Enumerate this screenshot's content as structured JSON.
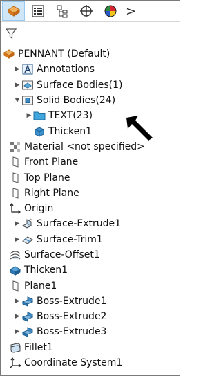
{
  "toolbar": {
    "buttons": [
      {
        "icon": "feature-manager-icon",
        "active": true
      },
      {
        "icon": "property-manager-icon",
        "active": false
      },
      {
        "icon": "configuration-manager-icon",
        "active": false
      },
      {
        "icon": "dimxpert-manager-icon",
        "active": false
      },
      {
        "icon": "display-manager-icon",
        "active": false
      }
    ],
    "more_label": ">"
  },
  "tree": {
    "root": "PENNANT (Default)",
    "items": [
      {
        "label": "Annotations"
      },
      {
        "label": "Surface Bodies(1)"
      },
      {
        "label": "Solid Bodies(24)"
      },
      {
        "label": "TEXT(23)"
      },
      {
        "label": "Thicken1"
      },
      {
        "label": "Material <not specified>"
      },
      {
        "label": "Front Plane"
      },
      {
        "label": "Top Plane"
      },
      {
        "label": "Right Plane"
      },
      {
        "label": "Origin"
      },
      {
        "label": "Surface-Extrude1"
      },
      {
        "label": "Surface-Trim1"
      },
      {
        "label": "Surface-Offset1"
      },
      {
        "label": "Thicken1"
      },
      {
        "label": "Plane1"
      },
      {
        "label": "Boss-Extrude1"
      },
      {
        "label": "Boss-Extrude2"
      },
      {
        "label": "Boss-Extrude3"
      },
      {
        "label": "Fillet1"
      },
      {
        "label": "Coordinate System1"
      }
    ]
  },
  "colors": {
    "accent": "#cfe6f8",
    "folder": "#3aa0d8",
    "orange": "#e8892c"
  }
}
